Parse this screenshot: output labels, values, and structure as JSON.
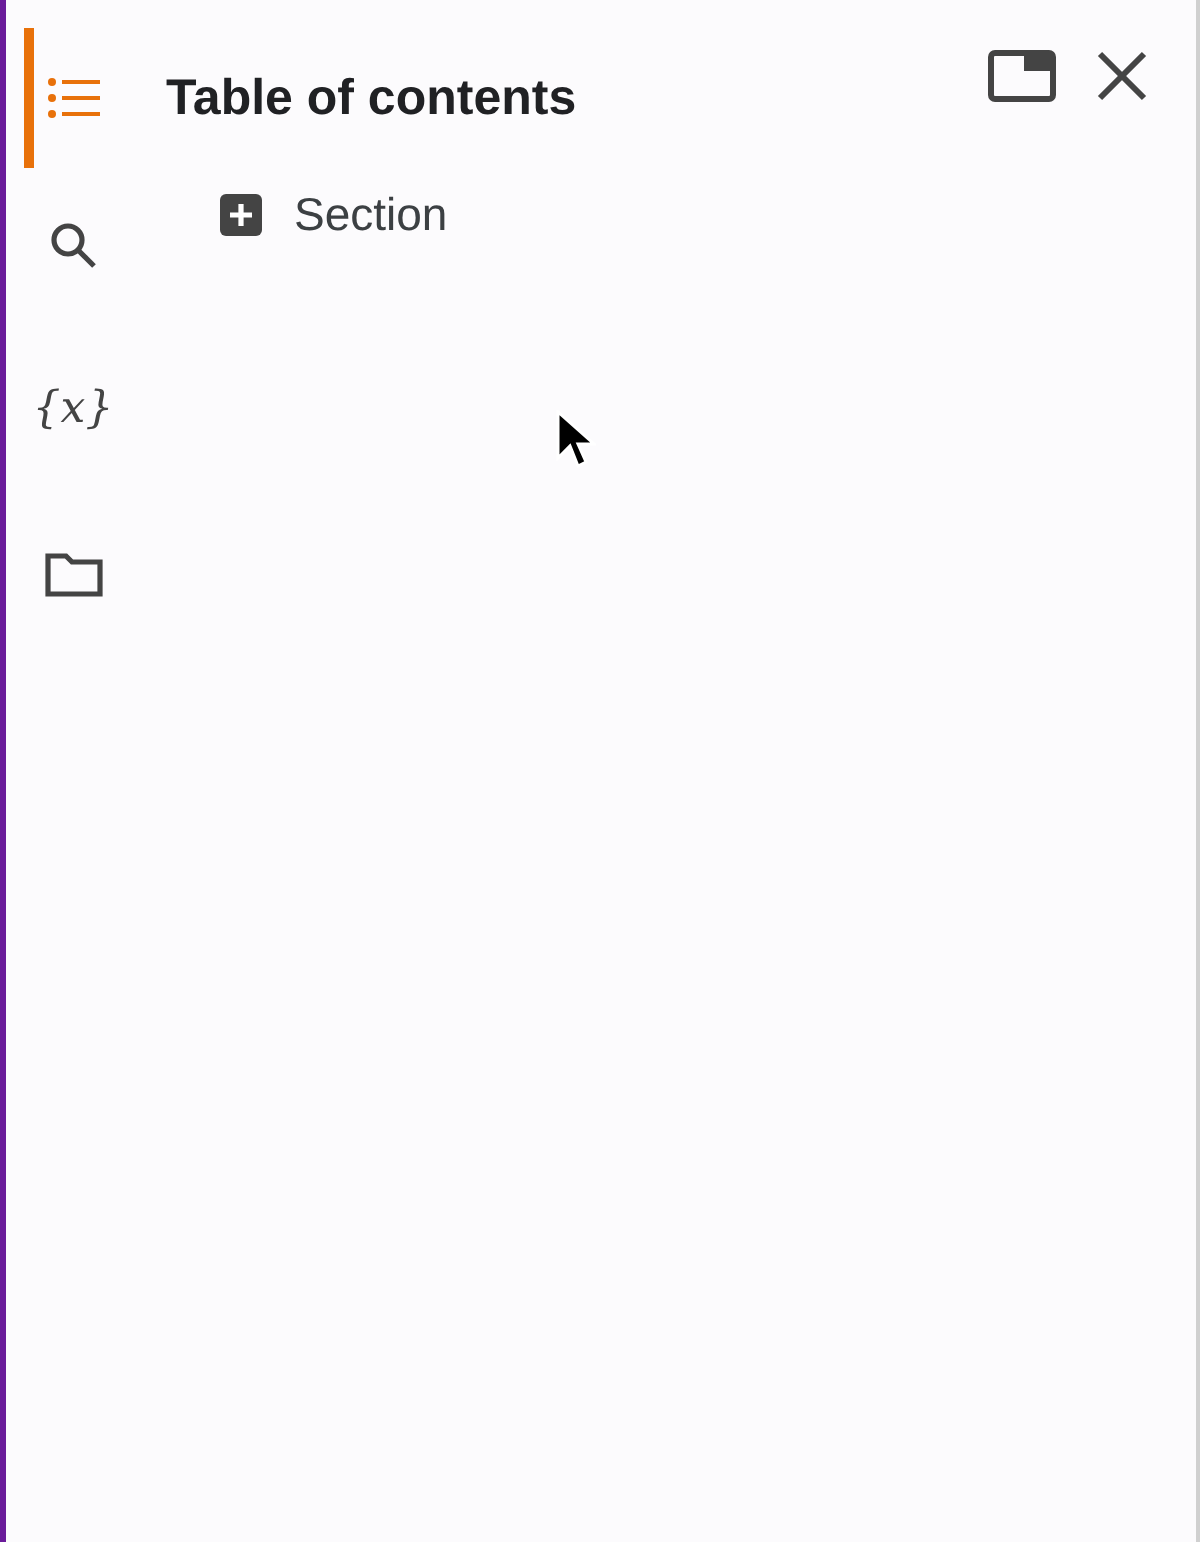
{
  "rail": [
    {
      "kind": "toc",
      "selected": true
    },
    {
      "kind": "search",
      "selected": false
    },
    {
      "kind": "glyph",
      "glyph": "{x}",
      "selected": false
    },
    {
      "kind": "files",
      "selected": false
    }
  ],
  "panel": {
    "title": "Table of contents",
    "actions": [
      {
        "kind": "popout"
      },
      {
        "kind": "close"
      }
    ]
  },
  "toc": [
    {
      "kind": "add",
      "label": "Section"
    }
  ],
  "cursor": true
}
